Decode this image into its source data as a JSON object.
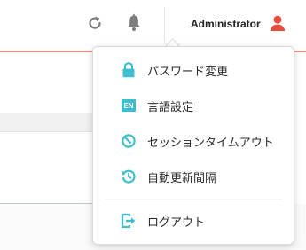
{
  "header": {
    "username": "Administrator",
    "icons": {
      "refresh": "refresh-icon",
      "notifications": "bell-icon",
      "user": "user-icon"
    },
    "accent_color": "#e84c3d"
  },
  "user_menu": {
    "items": [
      {
        "label": "パスワード変更",
        "icon": "lock-icon"
      },
      {
        "label": "言語設定",
        "icon": "en-language-icon",
        "badge": "EN"
      },
      {
        "label": "セッションタイムアウト",
        "icon": "timeout-icon"
      },
      {
        "label": "自動更新間隔",
        "icon": "auto-refresh-interval-icon"
      }
    ],
    "logout": {
      "label": "ログアウト",
      "icon": "logout-icon"
    },
    "icon_color": "#3dbfcf"
  }
}
